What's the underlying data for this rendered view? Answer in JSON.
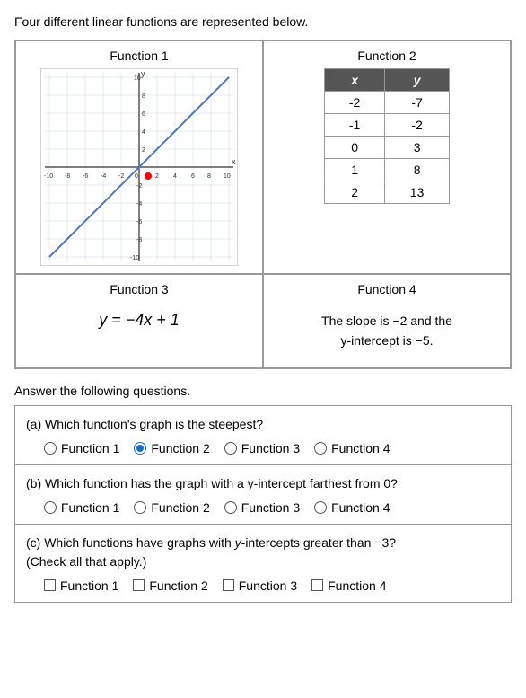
{
  "intro": "Four different linear functions are represented below.",
  "function1": {
    "title": "Function 1",
    "graph_label": "coordinate plane graph showing a line with positive slope"
  },
  "function2": {
    "title": "Function 2",
    "table_headers": [
      "x",
      "y"
    ],
    "table_rows": [
      [
        "-2",
        "-7"
      ],
      [
        "-1",
        "-2"
      ],
      [
        "0",
        "3"
      ],
      [
        "1",
        "8"
      ],
      [
        "2",
        "13"
      ]
    ]
  },
  "function3": {
    "title": "Function 3",
    "equation": "y = −4x + 1"
  },
  "function4": {
    "title": "Function 4",
    "description_line1": "The slope is −2 and the",
    "description_line2": "y-intercept is −5."
  },
  "answer_intro": "Answer the following questions.",
  "questions": [
    {
      "id": "a",
      "text": "(a) Which function's graph is the steepest?",
      "type": "radio",
      "options": [
        "Function 1",
        "Function 2",
        "Function 3",
        "Function 4"
      ],
      "selected": 1
    },
    {
      "id": "b",
      "text": "(b) Which function has the graph with a y-intercept farthest from 0?",
      "type": "radio",
      "options": [
        "Function 1",
        "Function 2",
        "Function 3",
        "Function 4"
      ],
      "selected": -1
    },
    {
      "id": "c",
      "text": "(c) Which functions have graphs with y-intercepts greater than −3?\n(Check all that apply.)",
      "type": "checkbox",
      "options": [
        "Function 1",
        "Function 2",
        "Function 3",
        "Function 4"
      ],
      "checked": []
    }
  ]
}
